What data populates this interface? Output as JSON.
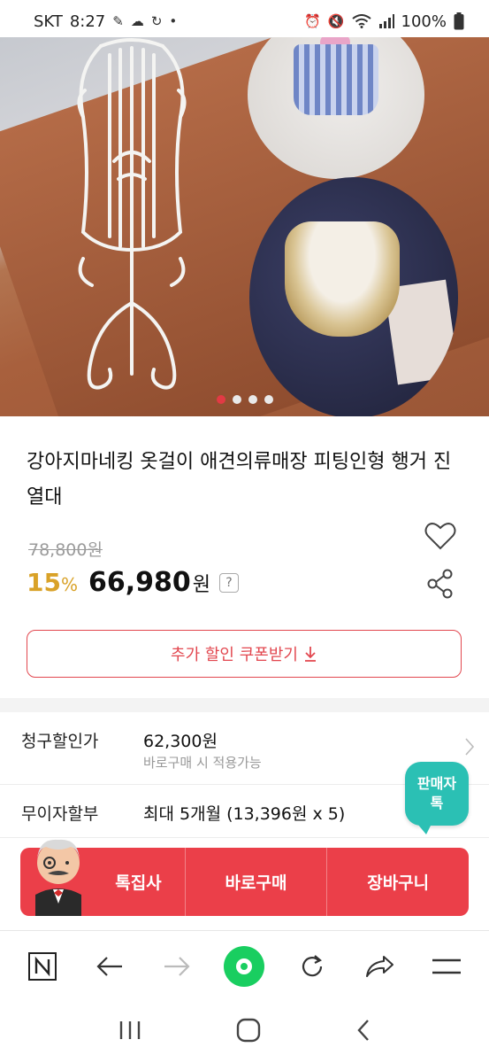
{
  "status_bar": {
    "carrier": "SKT",
    "time": "8:27",
    "battery": "100%",
    "icons": [
      "notification-icon",
      "cloud-icon",
      "sync-icon",
      "dot-icon",
      "alarm-icon",
      "mute-icon",
      "wifi-icon",
      "signal-icon",
      "battery-icon"
    ]
  },
  "carousel": {
    "slide_count": 4,
    "active_index": 0,
    "colors": {
      "active": "#e23a44",
      "inactive": "#e9e9e9"
    }
  },
  "product": {
    "title": "강아지마네킹 옷걸이 애견의류매장 피팅인형 행거 진열대",
    "original_price": "78,800원",
    "discount_rate": "15",
    "discount_unit": "%",
    "price": "66,980",
    "price_unit": "원",
    "help_badge": "?",
    "coupon_label": "추가 할인 쿠폰받기",
    "coupon_icon": "download-arrow-icon"
  },
  "info_rows": [
    {
      "label": "청구할인가",
      "value": "62,300원",
      "sub": "바로구매 시 적용가능"
    },
    {
      "label": "무이자할부",
      "value": "최대 5개월 (13,396원 x 5)",
      "sub": ""
    }
  ],
  "seller_chat": {
    "line1": "판매자",
    "line2": "톡"
  },
  "buy_bar": {
    "talk": "톡집사",
    "buy_now": "바로구매",
    "cart": "장바구니",
    "color": "#eb3f49"
  },
  "browser_bar": {
    "items": [
      "naver-n-icon",
      "back-arrow-icon",
      "forward-arrow-icon",
      "home-green-icon",
      "reload-icon",
      "share-icon",
      "menu-icon"
    ],
    "accent": "#19ce60"
  },
  "nav_bar": {
    "items": [
      "recent-apps-icon",
      "home-icon",
      "back-icon"
    ]
  }
}
